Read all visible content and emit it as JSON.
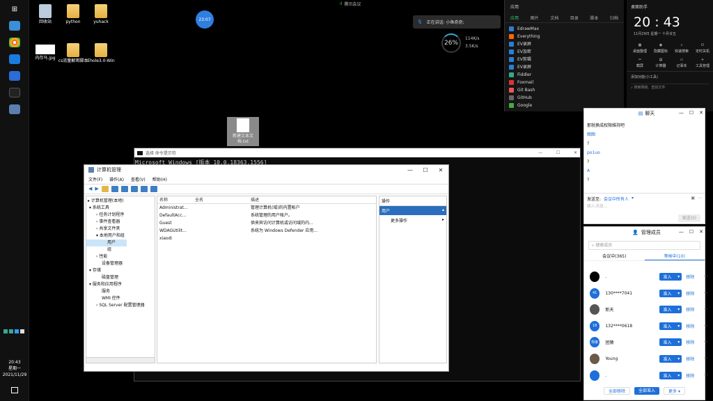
{
  "desktop": {
    "icons": [
      {
        "label": "回收站"
      },
      {
        "label": "python"
      },
      {
        "label": "yuhack"
      },
      {
        "label": "内存马.jpg"
      },
      {
        "label": "cs流量解密脚本"
      },
      {
        "label": "Ehole3.0-Win"
      }
    ],
    "selected_file_label": "新建文本文档.txt"
  },
  "timer_badge": "23:07",
  "meeting_bar": {
    "label": "腾讯会议"
  },
  "speaking_bar": {
    "label": "正在讲话: 小鱼奇奇;"
  },
  "net_widget": {
    "percent": "26%",
    "up": "114K/s",
    "down": "3.5K/s"
  },
  "launcher": {
    "header": "应用",
    "tabs": [
      "应用",
      "图片",
      "文档",
      "目录",
      "脚本",
      "归档"
    ],
    "apps": [
      "EdrawMax",
      "Everything",
      "EV录屏",
      "EV加密",
      "EV剪辑",
      "EV录屏",
      "Fiddler",
      "Foxmail",
      "Git Bash",
      "GitHub",
      "Google"
    ]
  },
  "clock_widget": {
    "title": "桌面助手",
    "time": "20 : 43",
    "date": "11月29日  星期一  十月廿五",
    "tools": [
      "桌面整理",
      "隐藏图标",
      "快速搜索",
      "定时关机",
      "截屏",
      "计算器",
      "记事本",
      "工具管理"
    ],
    "link": "添加功能(小工具)",
    "search_placeholder": "搜索网络、查找文件"
  },
  "cmd": {
    "title": "选择 命令提示符",
    "text": "Microsoft Windows [版本 10.0.18363.1556]"
  },
  "mmc": {
    "title": "计算机管理",
    "menu": [
      "文件(F)",
      "操作(A)",
      "查看(V)",
      "帮助(H)"
    ],
    "tree": [
      "计算机管理(本地)",
      "系统工具",
      "任务计划程序",
      "事件查看器",
      "共享文件夹",
      "本地用户和组",
      "用户",
      "组",
      "性能",
      "设备管理器",
      "存储",
      "磁盘管理",
      "服务和应用程序",
      "服务",
      "WMI 控件",
      "SQL Server 配置管理器"
    ],
    "columns": [
      "名称",
      "全名",
      "描述"
    ],
    "users": [
      {
        "name": "Administrat...",
        "full": "",
        "desc": "管理计算机(域)的内置帐户"
      },
      {
        "name": "DefaultAcc...",
        "full": "",
        "desc": "系统管理的用户帐户。"
      },
      {
        "name": "Guest",
        "full": "",
        "desc": "供来宾访问计算机或访问域的内..."
      },
      {
        "name": "WDAGUtilit...",
        "full": "",
        "desc": "系统为 Windows Defender 应用..."
      },
      {
        "name": "xiaodi",
        "full": "",
        "desc": ""
      }
    ],
    "actions_header": "操作",
    "actions_section": "用户",
    "actions_more": "更多操作"
  },
  "chat": {
    "title": "聊天",
    "messages": [
      "那就换成权限维持吧",
      "图图",
      "?",
      "po1uo",
      "?",
      "A",
      "?"
    ],
    "send_to_label": "发送至:",
    "send_to_value": "会议中所有人",
    "input_placeholder": "输入消息...",
    "send_button": "发送(S)"
  },
  "members": {
    "title": "管理成员",
    "search_placeholder": "搜索成员",
    "tab_in_meeting": "会议中(365)",
    "tab_waiting": "等候中(10)",
    "admit_label": "准入",
    "remove_label": "移除",
    "more_label": "···",
    "list": [
      {
        "avatar": "",
        "name": "."
      },
      {
        "avatar": "41",
        "name": "130****7041"
      },
      {
        "avatar": "",
        "name": "新天"
      },
      {
        "avatar": "18",
        "name": "132****0618"
      },
      {
        "avatar": "你家",
        "name": "团猿"
      },
      {
        "avatar": "",
        "name": "Young"
      },
      {
        "avatar": "",
        "name": "."
      }
    ],
    "footer": [
      "全部移除",
      "全部准入",
      "更多"
    ]
  },
  "sidebar_clock": {
    "time": "20:43",
    "weekday": "星期一",
    "date": "2021/11/29"
  }
}
